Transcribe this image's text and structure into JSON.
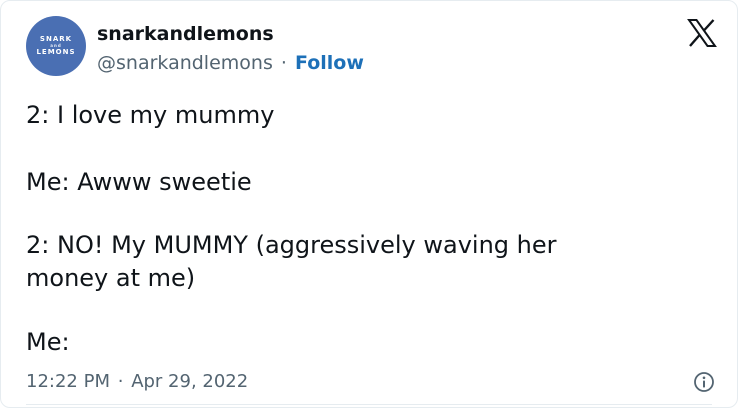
{
  "author": {
    "avatar_text": [
      "SNARK",
      "and",
      "LEMONS"
    ],
    "name": "snarkandlemons",
    "handle": "@snarkandlemons",
    "separator": "·",
    "follow_label": "Follow"
  },
  "tweet": {
    "lines": [
      "2: I love my mummy",
      "Me: Awww sweetie",
      "2: NO! My MUMMY (aggressively waving her",
      "money at me)",
      "Me:"
    ]
  },
  "meta": {
    "time": "12:22 PM",
    "separator": "·",
    "date": "Apr 29, 2022"
  },
  "icons": {
    "platform": "x-logo-icon",
    "info": "info-icon"
  },
  "colors": {
    "avatar": "#4a6fb3",
    "follow": "#1d70b8",
    "secondary_text": "#536471"
  }
}
